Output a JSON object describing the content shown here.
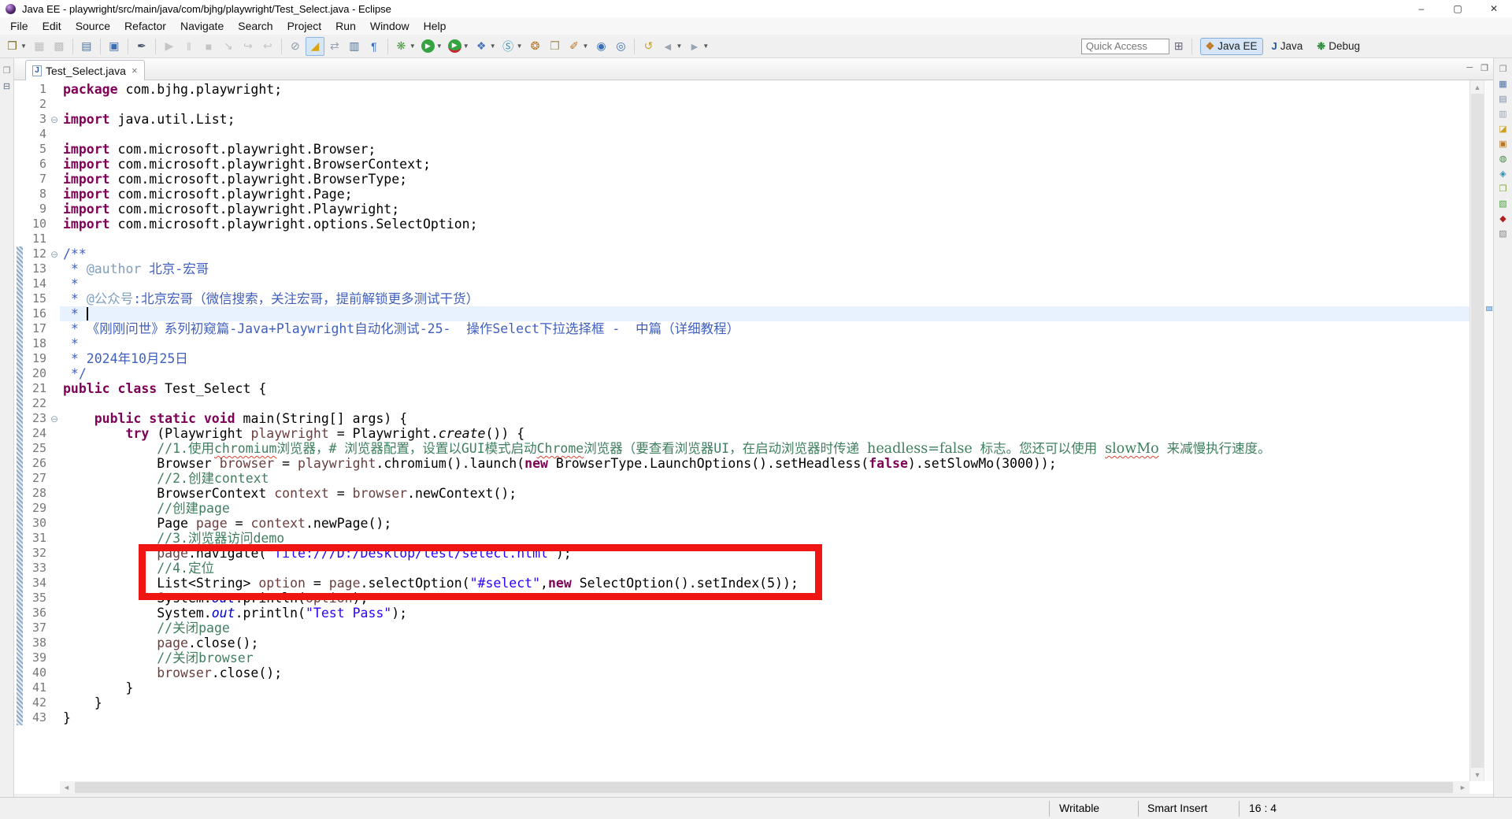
{
  "window": {
    "title": "Java EE - playwright/src/main/java/com/bjhg/playwright/Test_Select.java - Eclipse",
    "controls": {
      "minimize": "–",
      "maximize": "▢",
      "close": "✕"
    }
  },
  "menu": {
    "items": [
      "File",
      "Edit",
      "Source",
      "Refactor",
      "Navigate",
      "Search",
      "Project",
      "Run",
      "Window",
      "Help"
    ]
  },
  "toolbar": {
    "quick_access_label": "Quick Access",
    "items": [
      {
        "name": "new-wizard-button",
        "g": "❐",
        "c": "#7a6a2a",
        "dd": true
      },
      {
        "name": "save-button",
        "g": "▦",
        "c": "#bdbdbd"
      },
      {
        "name": "save-all-button",
        "g": "▩",
        "c": "#bdbdbd"
      },
      {
        "sep": true
      },
      {
        "name": "print-button",
        "g": "▤",
        "c": "#4a6f9b"
      },
      {
        "sep": true
      },
      {
        "name": "open-console-button",
        "g": "▣",
        "c": "#3b6fb5"
      },
      {
        "sep": true
      },
      {
        "name": "quill-button",
        "g": "✒",
        "c": "#44536a"
      },
      {
        "sep": true
      },
      {
        "name": "resume-button",
        "g": "▶",
        "c": "#c4c4c4"
      },
      {
        "name": "suspend-button",
        "g": "‖",
        "c": "#c4c4c4"
      },
      {
        "name": "terminate-button",
        "g": "■",
        "c": "#c4c4c4"
      },
      {
        "name": "step-into-button",
        "g": "↘",
        "c": "#c4c4c4"
      },
      {
        "name": "step-over-button",
        "g": "↪",
        "c": "#c4c4c4"
      },
      {
        "name": "step-return-button",
        "g": "↩",
        "c": "#c4c4c4"
      },
      {
        "sep": true
      },
      {
        "name": "skip-breakpoints-button",
        "g": "⊘",
        "c": "#8898aa"
      },
      {
        "name": "mark-occurrences-button",
        "g": "◢",
        "c": "#d9a514",
        "sel": true
      },
      {
        "name": "link-editor-button",
        "g": "⇄",
        "c": "#9aa5b1"
      },
      {
        "name": "show-whitespace-button",
        "g": "▥",
        "c": "#55708e"
      },
      {
        "name": "pilcrow-button",
        "g": "¶",
        "c": "#3b6fb5"
      },
      {
        "sep": true
      },
      {
        "name": "debug-button",
        "g": "❋",
        "c": "#4f9e44",
        "dd": true
      },
      {
        "name": "run-button",
        "g": "▶",
        "c": "#ffffff",
        "bg": "#35a33f",
        "dd": true
      },
      {
        "name": "coverage-button",
        "g": "▶",
        "c": "#ffffff",
        "bg": "#35a33f",
        "u": "#c23",
        "dd": true
      },
      {
        "name": "run-on-server-button",
        "g": "❖",
        "c": "#4a76b8",
        "dd": true
      },
      {
        "name": "web-service-button",
        "g": "Ⓢ",
        "c": "#2f8fae",
        "dd": true
      },
      {
        "name": "team-sync-button",
        "g": "❂",
        "c": "#b5762a"
      },
      {
        "name": "clipboard-button",
        "g": "❒",
        "c": "#a98f4e"
      },
      {
        "name": "annotation-button",
        "g": "✐",
        "c": "#b5762a",
        "dd": true
      },
      {
        "name": "web-browser-button",
        "g": "◉",
        "c": "#3b6fb5"
      },
      {
        "name": "web-page-button",
        "g": "◎",
        "c": "#3b6fb5"
      },
      {
        "sep": true
      },
      {
        "name": "last-edit-location-button",
        "g": "↺",
        "c": "#c2a23c"
      },
      {
        "name": "back-button",
        "g": "◄",
        "c": "#9aa5b1",
        "dd": true
      },
      {
        "name": "forward-button",
        "g": "►",
        "c": "#9aa5b1",
        "dd": true
      }
    ],
    "perspectives": [
      {
        "label": "Java EE",
        "icon": "❖",
        "icon_color": "#c07820",
        "selected": true
      },
      {
        "label": "Java",
        "icon": "J",
        "icon_color": "#2255aa",
        "selected": false
      },
      {
        "label": "Debug",
        "icon": "❉",
        "icon_color": "#2a8a3a",
        "selected": false
      }
    ],
    "open_perspective_icon": "⊞"
  },
  "left_trim": [
    {
      "name": "restore-view-icon",
      "g": "❐",
      "c": "#8a8a8a"
    },
    {
      "name": "project-explorer-icon",
      "g": "⊟",
      "c": "#55708e"
    }
  ],
  "right_trim": [
    {
      "name": "restore-views-icon",
      "g": "❐",
      "c": "#8a8a8a"
    },
    {
      "name": "minimized-view-icon-1",
      "g": "▦",
      "c": "#4a6fa5"
    },
    {
      "name": "minimized-view-icon-2",
      "g": "▤",
      "c": "#7c8aa0"
    },
    {
      "name": "minimized-view-icon-3",
      "g": "▥",
      "c": "#9aa5b1"
    },
    {
      "name": "minimized-view-icon-4",
      "g": "◪",
      "c": "#c9a227"
    },
    {
      "name": "minimized-view-icon-5",
      "g": "▣",
      "c": "#b5762a"
    },
    {
      "name": "minimized-view-icon-6",
      "g": "◍",
      "c": "#3a8a3a"
    },
    {
      "name": "minimized-view-icon-7",
      "g": "◈",
      "c": "#2f8fae"
    },
    {
      "name": "minimized-view-icon-8",
      "g": "❒",
      "c": "#7aa03a"
    },
    {
      "name": "minimized-view-icon-9",
      "g": "▧",
      "c": "#4f9e44"
    },
    {
      "name": "minimized-view-icon-10",
      "g": "◆",
      "c": "#b02020"
    },
    {
      "name": "minimized-view-icon-11",
      "g": "▨",
      "c": "#888888"
    }
  ],
  "editor": {
    "tab": {
      "label": "Test_Select.java",
      "close_glyph": "×"
    },
    "current_line": 16,
    "caret": {
      "line": 16,
      "column": 4
    },
    "folds": [
      3,
      12,
      23
    ],
    "range_indicator": {
      "from_line": 12,
      "to_line": 43
    },
    "lines": [
      [
        [
          "k",
          "package"
        ],
        [
          "p",
          " com.bjhg.playwright;"
        ]
      ],
      [],
      [
        [
          "k",
          "import"
        ],
        [
          "p",
          " java.util.List;"
        ]
      ],
      [],
      [
        [
          "k",
          "import"
        ],
        [
          "p",
          " com.microsoft.playwright.Browser;"
        ]
      ],
      [
        [
          "k",
          "import"
        ],
        [
          "p",
          " com.microsoft.playwright.BrowserContext;"
        ]
      ],
      [
        [
          "k",
          "import"
        ],
        [
          "p",
          " com.microsoft.playwright.BrowserType;"
        ]
      ],
      [
        [
          "k",
          "import"
        ],
        [
          "p",
          " com.microsoft.playwright.Page;"
        ]
      ],
      [
        [
          "k",
          "import"
        ],
        [
          "p",
          " com.microsoft.playwright.Playwright;"
        ]
      ],
      [
        [
          "k",
          "import"
        ],
        [
          "p",
          " com.microsoft.playwright.options.SelectOption;"
        ]
      ],
      [],
      [
        [
          "j",
          "/**"
        ]
      ],
      [
        [
          "j",
          " * "
        ],
        [
          "jt",
          "@author"
        ],
        [
          "j",
          " 北京-宏哥"
        ]
      ],
      [
        [
          "j",
          " * "
        ]
      ],
      [
        [
          "j",
          " * "
        ],
        [
          "jt",
          "@公众号"
        ],
        [
          "j",
          ":北京宏哥（微信搜索，关注宏哥，提前解锁更多测试干货）"
        ]
      ],
      [
        [
          "j",
          " * "
        ]
      ],
      [
        [
          "j",
          " * 《刚刚问世》系列初窥篇-Java+Playwright自动化测试-25-  操作Select下拉选择框 -  中篇（详细教程）"
        ]
      ],
      [
        [
          "j",
          " * "
        ]
      ],
      [
        [
          "j",
          " * 2024年10月25日"
        ]
      ],
      [
        [
          "j",
          " */"
        ]
      ],
      [
        [
          "k",
          "public"
        ],
        [
          "p",
          " "
        ],
        [
          "k",
          "class"
        ],
        [
          "p",
          " Test_Select {"
        ]
      ],
      [],
      [
        [
          "p",
          "    "
        ],
        [
          "k",
          "public"
        ],
        [
          "p",
          " "
        ],
        [
          "k",
          "static"
        ],
        [
          "p",
          " "
        ],
        [
          "k",
          "void"
        ],
        [
          "p",
          " main(String[] args) {"
        ]
      ],
      [
        [
          "p",
          "        "
        ],
        [
          "k",
          "try"
        ],
        [
          "p",
          " (Playwright "
        ],
        [
          "v",
          "playwright"
        ],
        [
          "p",
          " = Playwright."
        ],
        [
          "sm",
          "create"
        ],
        [
          "p",
          "()) {"
        ]
      ],
      [
        [
          "p",
          "            "
        ],
        [
          "c",
          "//1.使用"
        ],
        [
          "ce",
          "chromium"
        ],
        [
          "c",
          "浏览器，# 浏览器配置，设置以GUI模式启动"
        ],
        [
          "ce",
          "Chrome"
        ],
        [
          "c",
          "浏览器（要查看浏览器UI，在启动浏览器时传递 "
        ],
        [
          "cb",
          "headless=false"
        ],
        [
          "c",
          " 标志。您还可以使用 "
        ],
        [
          "cbe",
          "slowMo"
        ],
        [
          "c",
          " 来减慢执行速度。"
        ]
      ],
      [
        [
          "p",
          "            Browser "
        ],
        [
          "v",
          "browser"
        ],
        [
          "p",
          " = "
        ],
        [
          "v",
          "playwright"
        ],
        [
          "p",
          ".chromium().launch("
        ],
        [
          "k",
          "new"
        ],
        [
          "p",
          " BrowserType.LaunchOptions().setHeadless("
        ],
        [
          "k",
          "false"
        ],
        [
          "p",
          ").setSlowMo(3000));"
        ]
      ],
      [
        [
          "p",
          "            "
        ],
        [
          "c",
          "//2.创建context"
        ]
      ],
      [
        [
          "p",
          "            BrowserContext "
        ],
        [
          "v",
          "context"
        ],
        [
          "p",
          " = "
        ],
        [
          "v",
          "browser"
        ],
        [
          "p",
          ".newContext();"
        ]
      ],
      [
        [
          "p",
          "            "
        ],
        [
          "c",
          "//创建page"
        ]
      ],
      [
        [
          "p",
          "            Page "
        ],
        [
          "v",
          "page"
        ],
        [
          "p",
          " = "
        ],
        [
          "v",
          "context"
        ],
        [
          "p",
          ".newPage();"
        ]
      ],
      [
        [
          "p",
          "            "
        ],
        [
          "c",
          "//3.浏览器访问demo"
        ]
      ],
      [
        [
          "p",
          "            "
        ],
        [
          "v",
          "page"
        ],
        [
          "p",
          ".navigate("
        ],
        [
          "s",
          "\"file:///D:/Desktop/test/select.html\""
        ],
        [
          "p",
          ");"
        ]
      ],
      [
        [
          "p",
          "            "
        ],
        [
          "c",
          "//4.定位"
        ]
      ],
      [
        [
          "p",
          "            List<String> "
        ],
        [
          "v",
          "option"
        ],
        [
          "p",
          " = "
        ],
        [
          "v",
          "page"
        ],
        [
          "p",
          ".selectOption("
        ],
        [
          "s",
          "\"#select\""
        ],
        [
          "p",
          ","
        ],
        [
          "k",
          "new"
        ],
        [
          "p",
          " SelectOption().setIndex(5));"
        ]
      ],
      [
        [
          "p",
          "            System."
        ],
        [
          "sf",
          "out"
        ],
        [
          "p",
          ".println("
        ],
        [
          "v",
          "option"
        ],
        [
          "p",
          ");"
        ]
      ],
      [
        [
          "p",
          "            System."
        ],
        [
          "sf",
          "out"
        ],
        [
          "p",
          ".println("
        ],
        [
          "s",
          "\"Test Pass\""
        ],
        [
          "p",
          ");"
        ]
      ],
      [
        [
          "p",
          "            "
        ],
        [
          "c",
          "//关闭page"
        ]
      ],
      [
        [
          "p",
          "            "
        ],
        [
          "v",
          "page"
        ],
        [
          "p",
          ".close();"
        ]
      ],
      [
        [
          "p",
          "            "
        ],
        [
          "c",
          "//关闭browser"
        ]
      ],
      [
        [
          "p",
          "            "
        ],
        [
          "v",
          "browser"
        ],
        [
          "p",
          ".close();"
        ]
      ],
      [
        [
          "p",
          "        }"
        ]
      ],
      [
        [
          "p",
          "    }"
        ]
      ],
      [
        [
          "p",
          "}"
        ]
      ]
    ]
  },
  "statusbar": {
    "writable": "Writable",
    "insert_mode": "Smart Insert",
    "position": "16 : 4"
  },
  "colors": {
    "keyword": "#7f0055",
    "string": "#2a00ff",
    "comment": "#3f7f5f",
    "javadoc": "#3f5fbf",
    "javadoc_tag": "#7f9fbf",
    "local_variable": "#6a3e3e",
    "static_field": "#0000c0",
    "current_line_bg": "#e8f2fe",
    "red_highlight_box": "#ee1512",
    "line_number": "#787878"
  }
}
